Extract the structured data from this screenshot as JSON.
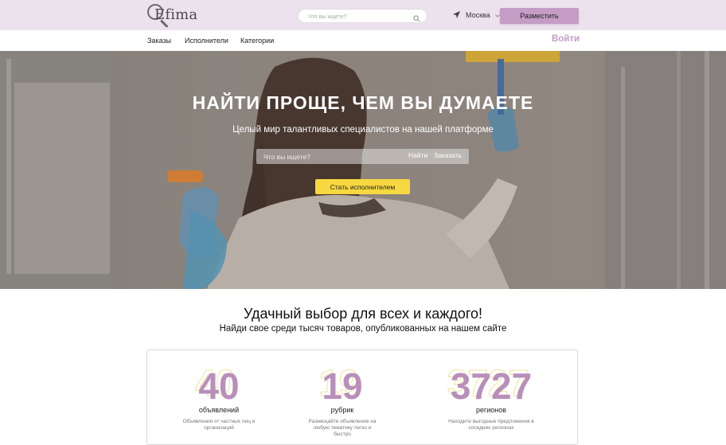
{
  "header": {
    "logo_text": "Efima",
    "search_placeholder": "Что вы ищете?",
    "city": "Москва",
    "post_button": "Разместить"
  },
  "nav": {
    "items": [
      "Заказы",
      "Исполнители",
      "Категории"
    ],
    "login": "Войти"
  },
  "hero": {
    "title": "НАЙТИ ПРОЩЕ, ЧЕМ ВЫ ДУМАЕТЕ",
    "subtitle": "Целый мир талантливых специалистов на нашей платформе",
    "search_placeholder": "Что вы ищете?",
    "find_label": "Найти",
    "order_label": "Заказать",
    "become_button": "Стать исполнителем"
  },
  "section": {
    "title": "Удачный выбор для всех и каждого!",
    "subtitle": "Найди свое среди тысяч товаров, опубликованных на нашем сайте"
  },
  "stats": [
    {
      "value": "40",
      "label": "объявлений",
      "desc": "Объявления от частных лиц и организаций"
    },
    {
      "value": "19",
      "label": "рубрик",
      "desc": "Размещайте объявление на любую тематику легко и быстро"
    },
    {
      "value": "3727",
      "label": "регионов",
      "desc": "Находите выгодные предложения в соседних регионах"
    }
  ],
  "colors": {
    "accent": "#c49cc5",
    "header_bg": "#ece2ee",
    "yellow": "#f7d840",
    "stat_number": "#b88fba"
  }
}
